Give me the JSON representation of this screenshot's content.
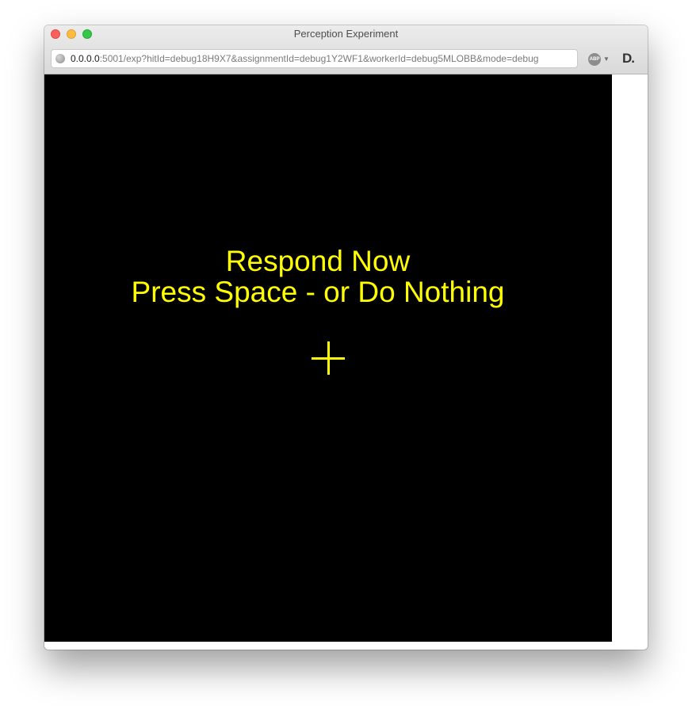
{
  "window": {
    "title": "Perception Experiment"
  },
  "address_bar": {
    "host": "0.0.0.0",
    "rest": ":5001/exp?hitId=debug18H9X7&assignmentId=debug1Y2WF1&workerId=debug5MLOBB&mode=debug",
    "icon": "globe-icon"
  },
  "extensions": {
    "adblock_label": "ABP",
    "adblock_icon": "adblock-plus-icon",
    "dropdown_glyph": "▼",
    "d_extension_label": "D.",
    "d_extension_icon": "d-extension-icon"
  },
  "stimulus": {
    "line1": "Respond Now",
    "line2": "Press Space - or Do Nothing",
    "fixation": "fixation-cross-icon",
    "text_color": "#ffff00",
    "background_color": "#000000"
  }
}
